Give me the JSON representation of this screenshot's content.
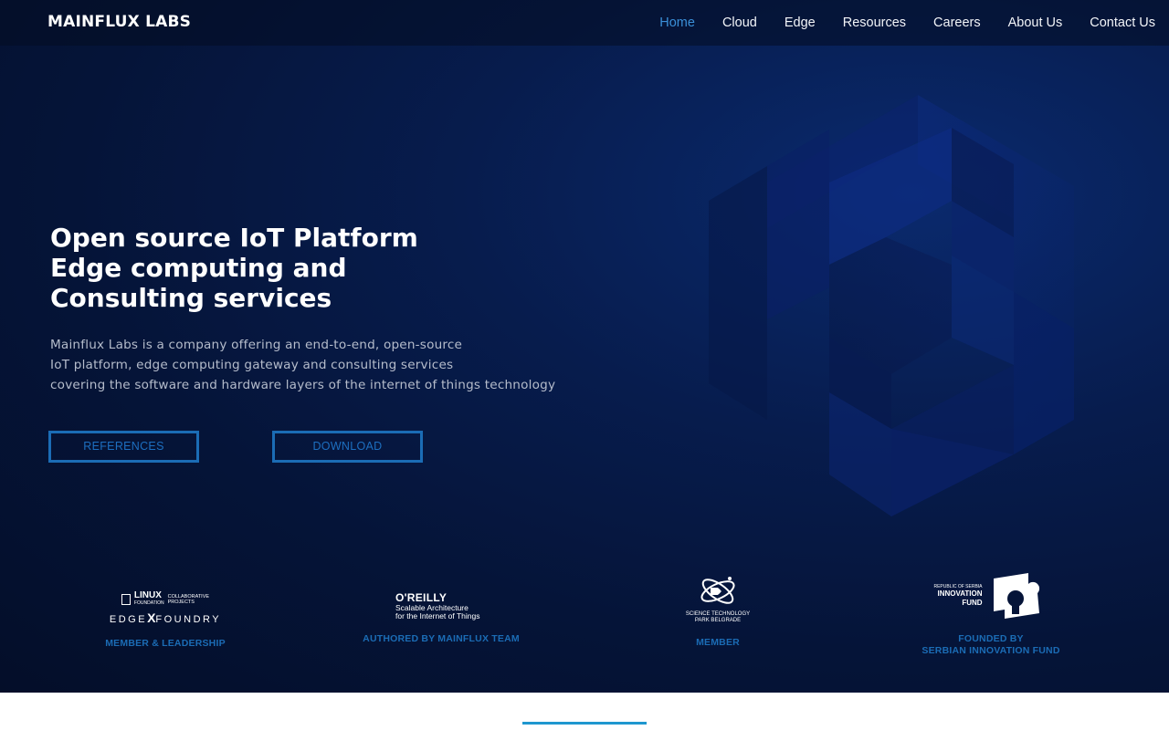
{
  "brand": "MAINFLUX LABS",
  "nav": {
    "items": [
      {
        "label": "Home",
        "active": true
      },
      {
        "label": "Cloud"
      },
      {
        "label": "Edge"
      },
      {
        "label": "Resources"
      },
      {
        "label": "Careers"
      },
      {
        "label": "About Us"
      },
      {
        "label": "Contact Us"
      }
    ]
  },
  "hero": {
    "headline": [
      "Open source IoT Platform",
      "Edge computing and",
      "Consulting services"
    ],
    "description": [
      "Mainflux Labs is a company offering an end-to-end, open-source",
      "IoT platform, edge computing gateway and consulting services",
      "covering the software and hardware layers of the internet of things technology"
    ],
    "buttons": {
      "references": "REFERENCES",
      "download": "DOWNLOAD"
    }
  },
  "partners": [
    {
      "logo": {
        "line1": "LINUX",
        "line2": "FOUNDATION",
        "collab1": "COLLABORATIVE",
        "collab2": "PROJECTS",
        "edgex_left": "EDGE",
        "edgex_mid": "X",
        "edgex_right": "FOUNDRY"
      },
      "caption": "MEMBER & LEADERSHIP"
    },
    {
      "logo": {
        "name": "O'REILLY",
        "sub1": "Scalable Architecture",
        "sub2": "for the Internet of Things"
      },
      "caption": "AUTHORED BY MAINFLUX TEAM"
    },
    {
      "logo": {
        "line1": "SCIENCE TECHNOLOGY",
        "line2": "PARK BELGRADE"
      },
      "caption": "MEMBER"
    },
    {
      "logo": {
        "tiny": "REPUBLIC OF SERBIA",
        "line1": "INNOVATION",
        "line2": "FUND"
      },
      "caption_lines": [
        "FOUNDED BY",
        "SERBIAN INNOVATION FUND"
      ]
    }
  ],
  "colors": {
    "accent": "#1b6cb5",
    "nav_active": "#3a8fd8",
    "bottom_line": "#1e97cf"
  }
}
